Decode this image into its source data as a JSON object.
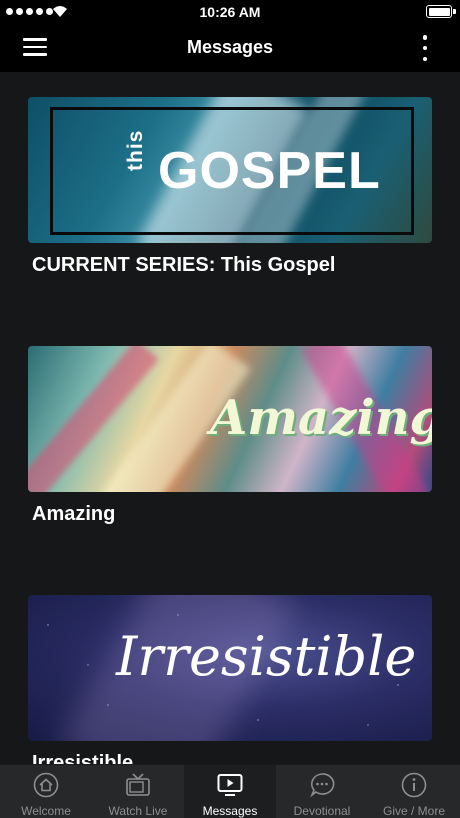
{
  "status_bar": {
    "time": "10:26 AM"
  },
  "header": {
    "title": "Messages"
  },
  "cards": [
    {
      "title": "CURRENT SERIES:  This Gospel",
      "art_small_text": "this",
      "art_text": "GOSPEL"
    },
    {
      "title": "Amazing",
      "art_text": "Amazing"
    },
    {
      "title": "Irresistible",
      "art_text": "Irresistible"
    }
  ],
  "tabs": [
    {
      "label": "Welcome",
      "icon": "home-icon"
    },
    {
      "label": "Watch Live",
      "icon": "tv-icon"
    },
    {
      "label": "Messages",
      "icon": "play-screen-icon"
    },
    {
      "label": "Devotional",
      "icon": "chat-bubble-icon"
    },
    {
      "label": "Give / More",
      "icon": "info-icon"
    }
  ],
  "active_tab": "Messages"
}
